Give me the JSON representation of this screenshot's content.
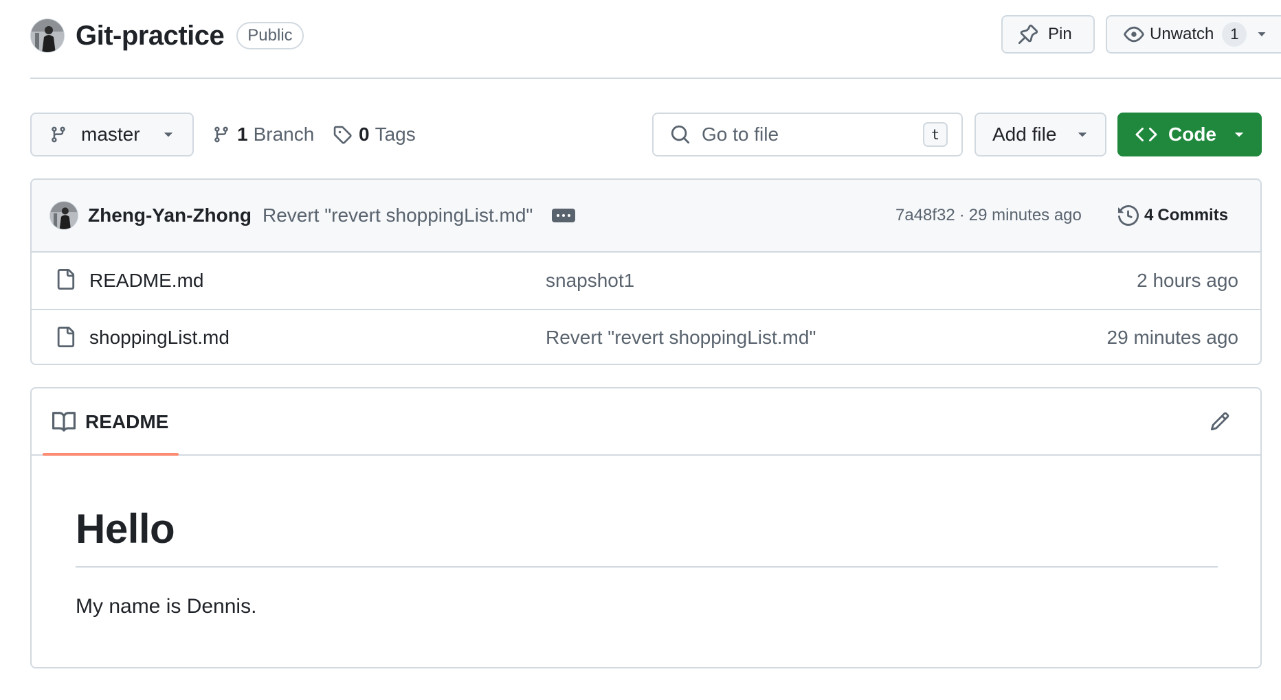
{
  "repo": {
    "name": "Git-practice",
    "visibility": "Public"
  },
  "actions": {
    "pin_label": "Pin",
    "unwatch_label": "Unwatch",
    "watchers_count": "1"
  },
  "toolbar": {
    "branch": "master",
    "branches_count": "1",
    "branches_label": "Branch",
    "tags_count": "0",
    "tags_label": "Tags",
    "search_placeholder": "Go to file",
    "search_shortcut": "t",
    "add_file_label": "Add file",
    "code_label": "Code",
    "code_button_color": "#1f883d"
  },
  "latest_commit": {
    "author": "Zheng-Yan-Zhong",
    "message": "Revert \"revert shoppingList.md\"",
    "hash": "7a48f32",
    "separator": "·",
    "time": "29 minutes ago",
    "commits_count": "4",
    "commits_label": "Commits"
  },
  "files": [
    {
      "name": "README.md",
      "icon": "file-icon",
      "message": "snapshot1",
      "age": "2 hours ago"
    },
    {
      "name": "shoppingList.md",
      "icon": "file-icon",
      "message": "Revert \"revert shoppingList.md\"",
      "age": "29 minutes ago"
    }
  ],
  "readme": {
    "tab_label": "README",
    "tab_accent_color": "#fd8c73",
    "heading": "Hello",
    "paragraph": "My name is Dennis."
  }
}
